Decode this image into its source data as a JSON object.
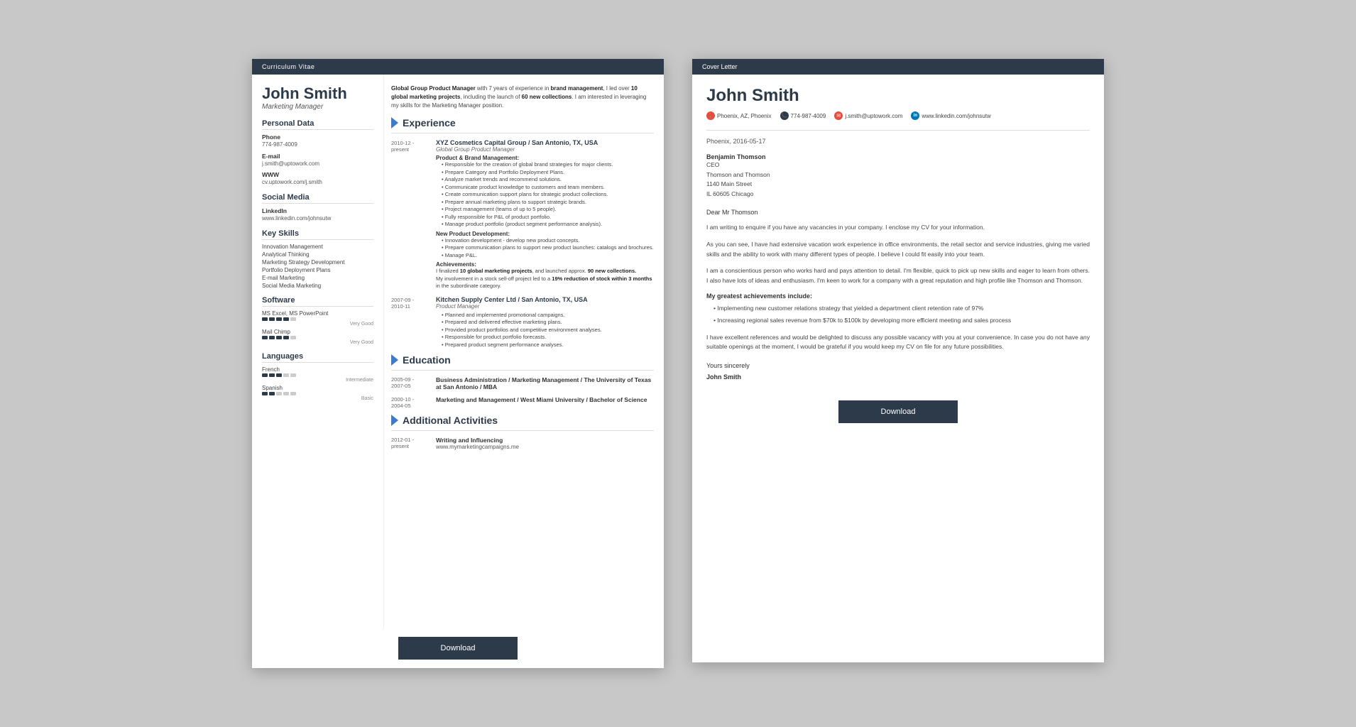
{
  "cv": {
    "header_bar": "Curriculum Vitae",
    "name": "John Smith",
    "title": "Marketing Manager",
    "intro": "Global Group Product Manager with 7 years of experience in brand management, I led over 10 global marketing projects, including the launch of 60 new collections. I am interested in leveraging my skills for the Marketing Manager position.",
    "sections": {
      "personal_data": "Personal Data",
      "phone_label": "Phone",
      "phone": "774-987-4009",
      "email_label": "E-mail",
      "email": "j.smith@uptowork.com",
      "www_label": "WWW",
      "www": "cv.uptowork.com/j.smith",
      "social_media": "Social Media",
      "linkedin_label": "LinkedIn",
      "linkedin": "www.linkedin.com/johnsutw",
      "key_skills": "Key Skills",
      "skills": [
        "Innovation Management",
        "Analytical Thinking",
        "Marketing Strategy Development",
        "Portfolio Deployment Plans",
        "E-mail Marketing",
        "Social Media Marketing"
      ],
      "software": "Software",
      "software_items": [
        {
          "name": "MS Excel, MS PowerPoint",
          "rating": 4,
          "label": "Very Good"
        },
        {
          "name": "Mail Chimp",
          "rating": 4,
          "label": "Very Good"
        }
      ],
      "languages": "Languages",
      "language_items": [
        {
          "name": "French",
          "rating": 3,
          "label": "Intermediate"
        },
        {
          "name": "Spanish",
          "rating": 2,
          "label": "Basic"
        }
      ]
    },
    "experience_title": "Experience",
    "experience": [
      {
        "date": "2010-12 - present",
        "company": "XYZ Cosmetics Capital Group / San Antonio, TX, USA",
        "job_title": "Global Group Product Manager",
        "sections": [
          {
            "title": "Product & Brand Management:",
            "bullets": [
              "Responsible for the creation of global brand strategies for major clients.",
              "Prepare Category and Portfolio Deployment Plans.",
              "Analyze market trends and recommend solutions.",
              "Communicate product knowledge to customers and team members.",
              "Create communication support plans for strategic product collections.",
              "Prepare annual marketing plans to support strategic brands.",
              "Project management (teams of up to 5 people).",
              "Fully responsible for P&L of product portfolio.",
              "Manage product portfolio (product segment performance analysis)."
            ]
          },
          {
            "title": "New Product Development:",
            "bullets": [
              "Innovation development - develop new product concepts.",
              "Prepare communication plans to support new product launches: catalogs and brochures.",
              "Manage P&L."
            ]
          },
          {
            "title": "Achievements:",
            "achievement_text": "I finalized 10 global marketing projects, and launched approx. 90 new collections.\nMy involvement in a stock sell-off project led to a 19% reduction of stock within 3 months in the subordinate category."
          }
        ]
      },
      {
        "date": "2007-09 - 2010-11",
        "company": "Kitchen Supply Center Ltd / San Antonio, TX, USA",
        "job_title": "Product Manager",
        "bullets": [
          "Planned and implemented promotional campaigns.",
          "Prepared and delivered effective marketing plans.",
          "Provided product portfolios and competitive environment analyses.",
          "Responsible for product portfolio forecasts.",
          "Prepared product segment performance analyses."
        ]
      }
    ],
    "education_title": "Education",
    "education": [
      {
        "date": "2005-09 - 2007-05",
        "title": "Business Administration / Marketing Management / The University of Texas at San Antonio / MBA"
      },
      {
        "date": "2000-10 - 2004-05",
        "title": "Marketing and Management / West Miami University / Bachelor of Science"
      }
    ],
    "activities_title": "Additional Activities",
    "activities": [
      {
        "date": "2012-01 - present",
        "title": "Writing and Influencing",
        "url": "www.mymarketingcampaigns.me"
      }
    ],
    "footer_btn": "Download"
  },
  "cover_letter": {
    "header_bar": "Cover Letter",
    "name": "John Smith",
    "contact": {
      "location": "Phoenix, AZ, Phoenix",
      "phone": "774-987-4009",
      "email": "j.smith@uptowork.com",
      "linkedin": "www.linkedin.com/johnsutw"
    },
    "date": "Phoenix, 2016-05-17",
    "recipient": {
      "name": "Benjamin Thomson",
      "title": "CEO",
      "company": "Thomson and Thomson",
      "address": "1140 Main Street",
      "city": "IL 60605 Chicago"
    },
    "greeting": "Dear Mr Thomson",
    "paragraphs": [
      "I am writing to enquire if you have any vacancies in your company. I enclose my CV for your information.",
      "As you can see, I have had extensive vacation work experience in office environments, the retail sector and service industries, giving me varied skills and the ability to work with many different types of people. I believe I could fit easily into your team.",
      "I am a conscientious person who works hard and pays attention to detail. I'm flexible, quick to pick up new skills and eager to learn from others. I also have lots of ideas and enthusiasm. I'm keen to work for a company with a great reputation and high profile like Thomson and Thomson."
    ],
    "achievements_title": "My greatest achievements include:",
    "achievements": [
      "Implementing new customer relations strategy that yielded a department client retention rate of 97%",
      "Increasing regional sales revenue from $70k to $100k by developing more efficient meeting and sales process"
    ],
    "closing": "I have excellent references and would be delighted to discuss any possible vacancy with you at your convenience. In case you do not have any suitable openings at the moment, I would be grateful if you would keep my CV on file for any future possibilities.",
    "sign_off": "Yours sincerely",
    "signature": "John Smith",
    "footer_btn": "Download"
  }
}
